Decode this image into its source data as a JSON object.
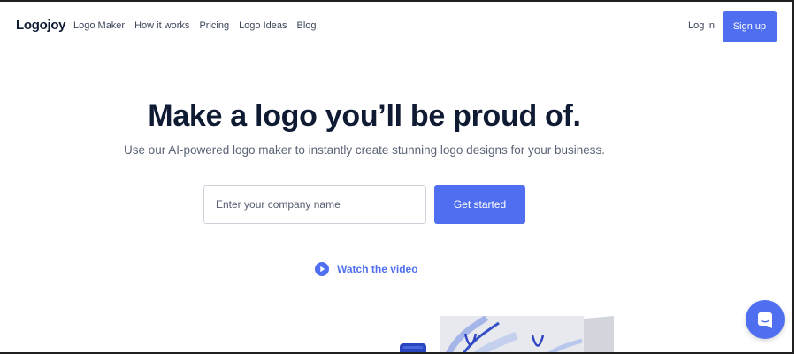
{
  "nav": {
    "logo": "Logojoy",
    "links": [
      "Logo Maker",
      "How it works",
      "Pricing",
      "Logo Ideas",
      "Blog"
    ],
    "login_label": "Log in",
    "signup_label": "Sign up"
  },
  "hero": {
    "headline": "Make a logo you’ll be proud of.",
    "subheadline": "Use our AI-powered logo maker to instantly create stunning logo designs for your business.",
    "company_input": {
      "value": "",
      "placeholder": "Enter your company name"
    },
    "cta_label": "Get started",
    "video_link_label": "Watch the video"
  },
  "icons": {
    "video": "play-circle-icon",
    "chat": "chat-bubble-icon"
  },
  "colors": {
    "accent": "#4f6ff0",
    "heading": "#0f1a33",
    "body_text": "#5b6477"
  }
}
